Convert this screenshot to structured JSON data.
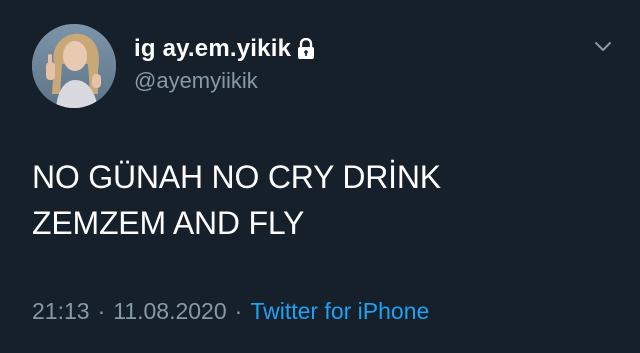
{
  "user": {
    "display_name": "ig ay.em.yikik",
    "handle": "@ayemyiikik",
    "protected_icon": "lock-icon",
    "avatar_icon": "avatar"
  },
  "tweet": {
    "lines": [
      "NO GÜNAH NO CRY DRİNK",
      "ZEMZEM AND FLY"
    ],
    "time": "21:13",
    "separator": "·",
    "date": "11.08.2020",
    "source": "Twitter for iPhone"
  },
  "menu": {
    "icon": "chevron-down-icon"
  },
  "colors": {
    "background": "#15202b",
    "primary_text": "#ffffff",
    "secondary_text": "#8899a6",
    "link": "#1da1f2"
  }
}
